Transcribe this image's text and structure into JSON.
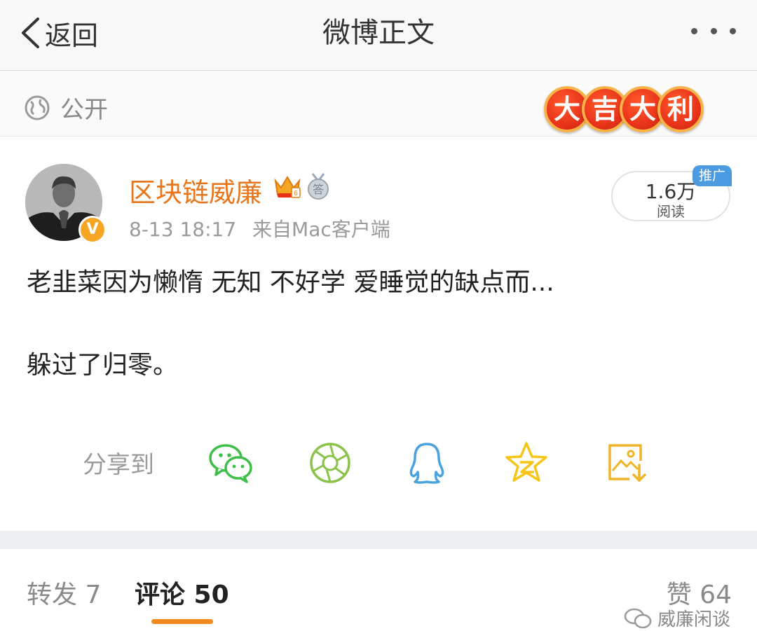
{
  "nav": {
    "back_label": "返回",
    "title": "微博正文"
  },
  "visibility": {
    "label": "公开",
    "banner_chars": [
      "大",
      "吉",
      "大",
      "利"
    ]
  },
  "post": {
    "username": "区块链威廉",
    "verified_badge": "V",
    "medal_text": "答",
    "time": "8-13 18:17",
    "source": "来自Mac客户端",
    "reads_count": "1.6万",
    "reads_label": "阅读",
    "promo_label": "推广",
    "text_line1": "老韭菜因为懒惰 无知 不好学 爱睡觉的缺点而...",
    "text_line2": "躲过了归零。"
  },
  "share": {
    "label": "分享到",
    "targets": [
      "wechat-icon",
      "moments-icon",
      "qq-icon",
      "qzone-icon",
      "save-image-icon"
    ]
  },
  "tabs": {
    "repost": "转发 7",
    "comments": "评论 50",
    "likes": "赞 64"
  },
  "watermark": "威廉闲谈",
  "colors": {
    "accent": "#f08a1d",
    "username": "#e8761c",
    "wechat": "#3fbf4a",
    "moments": "#8bc34a",
    "qq": "#4aa3df",
    "qzone": "#f5c518",
    "save": "#f0b429",
    "promo": "#4a9be0"
  }
}
